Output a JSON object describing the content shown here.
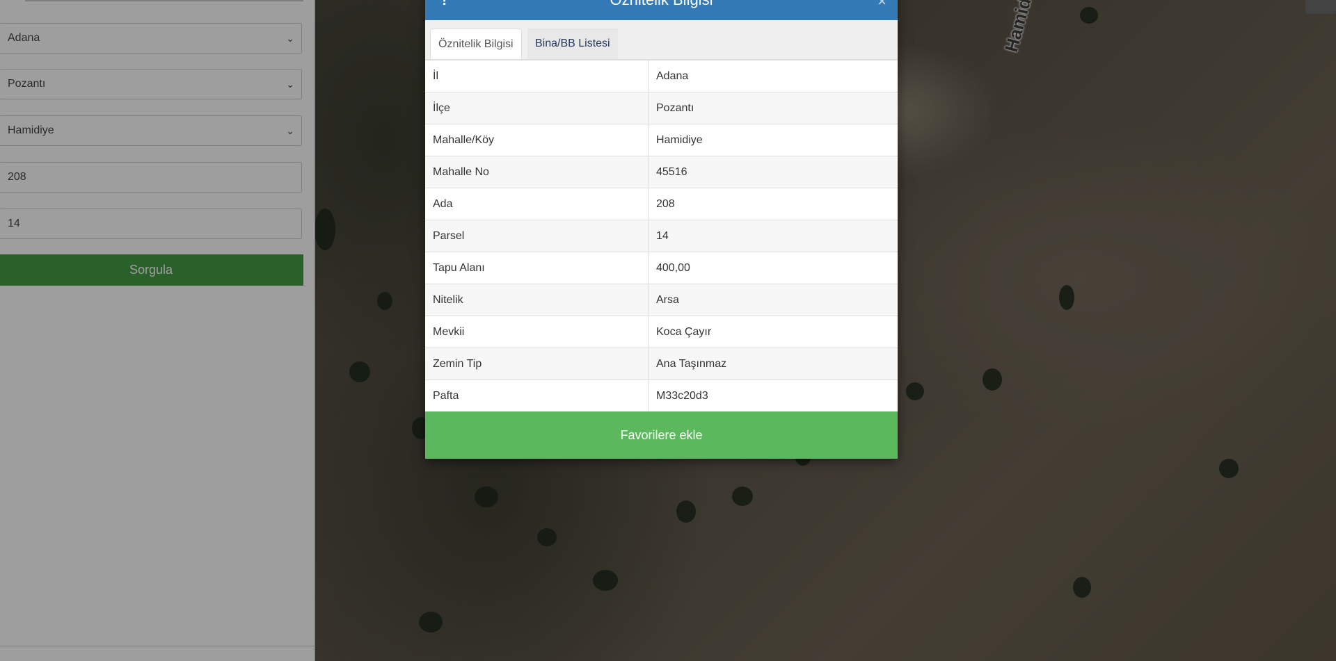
{
  "side_panel": {
    "il_select": "Adana",
    "ilce_select": "Pozantı",
    "mahalle_select": "Hamidiye",
    "ada_input": "208",
    "parsel_input": "14",
    "query_button": "Sorgula"
  },
  "map": {
    "road_label": "Hamidiye Mer"
  },
  "modal": {
    "title": "Öznitelik Bilgisi",
    "info_glyph": "!",
    "close_glyph": "×",
    "tabs": [
      {
        "label": "Öznitelik Bilgisi"
      },
      {
        "label": "Bina/BB Listesi"
      }
    ],
    "rows": [
      {
        "key": "İl",
        "value": "Adana"
      },
      {
        "key": "İlçe",
        "value": "Pozantı"
      },
      {
        "key": "Mahalle/Köy",
        "value": "Hamidiye"
      },
      {
        "key": "Mahalle No",
        "value": "45516"
      },
      {
        "key": "Ada",
        "value": "208"
      },
      {
        "key": "Parsel",
        "value": "14"
      },
      {
        "key": "Tapu Alanı",
        "value": "400,00"
      },
      {
        "key": "Nitelik",
        "value": "Arsa"
      },
      {
        "key": "Mevkii",
        "value": "Koca Çayır"
      },
      {
        "key": "Zemin Tip",
        "value": "Ana Taşınmaz"
      },
      {
        "key": "Pafta",
        "value": "M33c20d3"
      }
    ],
    "favorite_button": "Favorilere ekle"
  }
}
